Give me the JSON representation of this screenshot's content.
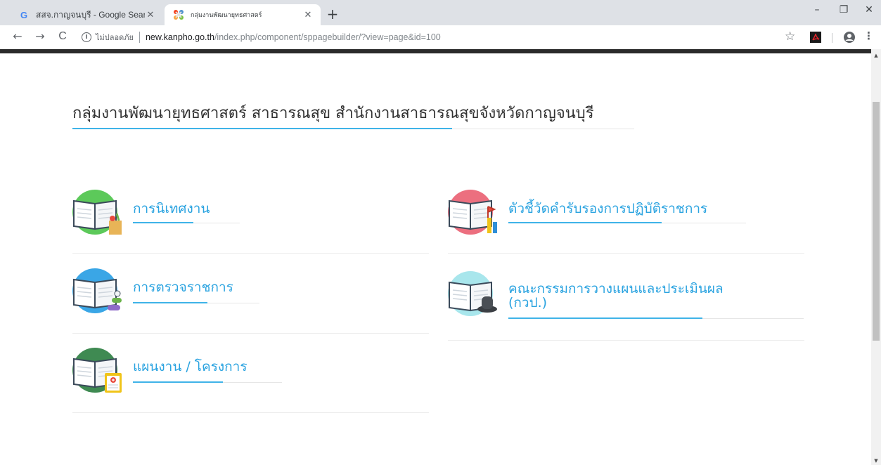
{
  "browser": {
    "tabs": [
      {
        "title": "สสจ.กาญจนบุรี - Google Search",
        "favicon": "google-g-icon"
      },
      {
        "title": "กลุ่มงานพัฒนายุทธศาสตร์",
        "favicon": "joomla-icon"
      }
    ],
    "new_tab": "+",
    "window": {
      "minimize": "–",
      "restore": "❐",
      "close": "✕"
    },
    "nav": {
      "back": "←",
      "forward": "→",
      "reload": "C"
    },
    "address": {
      "security_label": "ไม่ปลอดภัย",
      "host": "new.kanpho.go.th",
      "path": "/index.php/component/sppagebuilder/?view=page&id=100"
    },
    "bookmark_star": "☆",
    "menu": "⋮"
  },
  "page": {
    "heading": "กลุ่มงานพัฒนายุทธศาสตร์ สาธารณสุข สำนักงานสาธารณสุขจังหวัดกาญจนบุรี",
    "items": [
      {
        "label": "การนิเทศงาน",
        "icon": "book-groceries-icon",
        "circle_color": "#5cc95a"
      },
      {
        "label": "ตัวชี้วัดคำรับรองการปฏิบัติราชการ",
        "icon": "book-flag-icon",
        "circle_color": "#ec6f7f"
      },
      {
        "label": "การตรวจราชการ",
        "icon": "book-pills-icon",
        "circle_color": "#3aa6e6"
      },
      {
        "label_line1": "คณะกรรมการวางแผนและประเมินผล",
        "label_line2": "(กวป.)",
        "icon": "book-hat-icon",
        "circle_color": "#a8e6ec"
      },
      {
        "label": "แผนงาน / โครงการ",
        "icon": "book-clipboard-icon",
        "circle_color": "#3f8a52"
      }
    ]
  },
  "colors": {
    "accent": "#2aa3e0",
    "rule_accent": "#3fb3e8",
    "chrome": "#dee1e6"
  }
}
